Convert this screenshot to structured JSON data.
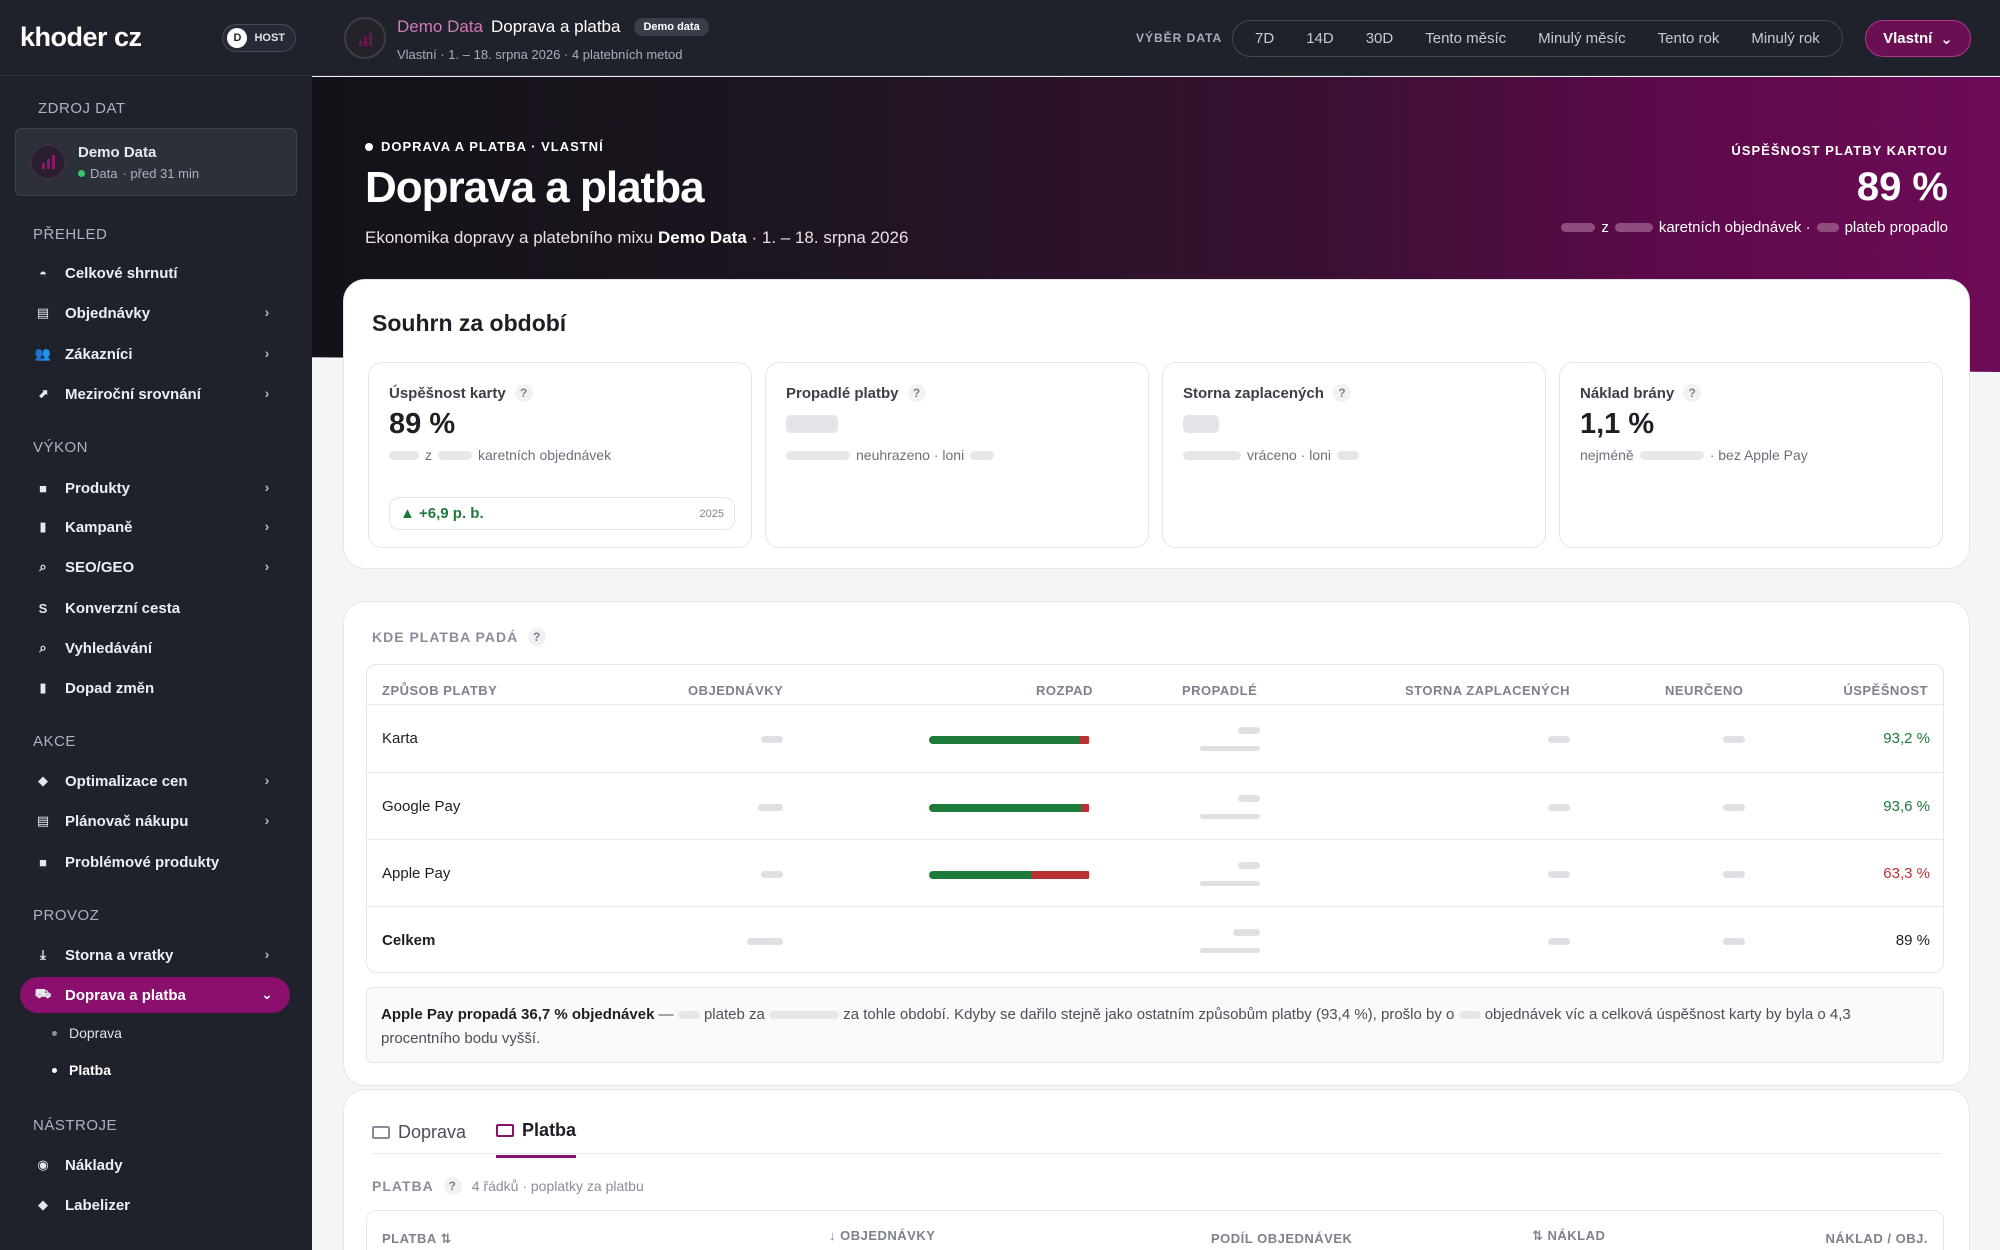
{
  "sidebar": {
    "brand": "khoder cz",
    "host": {
      "initial": "D",
      "label": "HOST"
    },
    "source": {
      "section": "ZDROJ DAT",
      "name": "Demo Data",
      "status": "Data",
      "time": "· před 31 min"
    },
    "sections": {
      "overview": "PŘEHLED",
      "performance": "VÝKON",
      "actions": "AKCE",
      "operations": "PROVOZ",
      "tools": "NÁSTROJE"
    },
    "items": [
      {
        "label": "Celkové shrnutí"
      },
      {
        "label": "Objednávky"
      },
      {
        "label": "Zákazníci"
      },
      {
        "label": "Meziroční srovnání"
      },
      {
        "label": "Produkty"
      },
      {
        "label": "Kampaně"
      },
      {
        "label": "SEO/GEO"
      },
      {
        "label": "Konverzní cesta"
      },
      {
        "label": "Vyhledávání"
      },
      {
        "label": "Dopad změn"
      },
      {
        "label": "Optimalizace cen"
      },
      {
        "label": "Plánovač nákupu"
      },
      {
        "label": "Problémové produkty"
      },
      {
        "label": "Storna a vratky"
      },
      {
        "label": "Doprava a platba"
      },
      {
        "label": "Náklady"
      },
      {
        "label": "Labelizer"
      }
    ],
    "subitems": [
      {
        "label": "Doprava"
      },
      {
        "label": "Platba"
      }
    ]
  },
  "topbar": {
    "crumb_source": "Demo Data",
    "crumb_page": "Doprava a platba",
    "badge": "Demo data",
    "subtitle": "Vlastní · 1. – 18. srpna 2026 · 4 platebních metod",
    "range_label": "VÝBĚR DATA",
    "ranges": [
      "7D",
      "14D",
      "30D",
      "Tento měsíc",
      "Minulý měsíc",
      "Tento rok",
      "Minulý rok"
    ],
    "custom": "Vlastní"
  },
  "hero": {
    "tag": "DOPRAVA A PLATBA · VLASTNÍ",
    "title": "Doprava a platba",
    "subtitle_pre": "Ekonomika dopravy a platebního mixu",
    "subtitle_bold": "Demo Data",
    "subtitle_post": "· 1. – 18. srpna 2026",
    "kpi_label": "ÚSPĚŠNOST PLATBY KARTOU",
    "kpi_value": "89 %",
    "kpi_z": "z",
    "kpi_mid": "karetních objednávek ·",
    "kpi_end": "plateb propadlo"
  },
  "summary": {
    "title": "Souhrn za období",
    "cards": [
      {
        "label": "Úspěšnost karty",
        "value": "89 %",
        "sub_z": "z",
        "sub": "karetních objednávek",
        "trend": "▲ +6,9 p. b.",
        "trend_year": "2025"
      },
      {
        "label": "Propadlé platby",
        "sub": "neuhrazeno · loni"
      },
      {
        "label": "Storna zaplacených",
        "sub": "vráceno · loni"
      },
      {
        "label": "Náklad brány",
        "value": "1,1 %",
        "sub_pre": "nejméně",
        "sub": "· bez Apple Pay"
      }
    ]
  },
  "failures": {
    "title": "KDE PLATBA PADÁ",
    "columns": [
      "ZPŮSOB PLATBY",
      "OBJEDNÁVKY",
      "ROZPAD",
      "PROPADLÉ",
      "STORNA ZAPLACENÝCH",
      "NEURČENO",
      "ÚSPĚŠNOST"
    ],
    "rows": [
      {
        "name": "Karta",
        "success": "93,2 %",
        "success_pct": 0.932,
        "color": "#1e7a3a"
      },
      {
        "name": "Google Pay",
        "success": "93,6 %",
        "success_pct": 0.936,
        "color": "#1e7a3a"
      },
      {
        "name": "Apple Pay",
        "success": "63,3 %",
        "success_pct": 0.633,
        "color": "#b83232"
      },
      {
        "name": "Celkem",
        "success": "89 %",
        "color": "#1d1f24"
      }
    ],
    "note_bold": "Apple Pay propadá 36,7 % objednávek",
    "note_1": "—",
    "note_2": "plateb za",
    "note_3": "za tohle období. Kdyby se dařilo stejně jako ostatním způsobům platby (93,4 %), prošlo by o",
    "note_4": "objednávek víc a celková úspěšnost karty by byla o 4,3 procentního bodu vyšší."
  },
  "detail": {
    "tabs": [
      {
        "label": "Doprava",
        "icon": "truck-icon"
      },
      {
        "label": "Platba",
        "icon": "card-icon"
      }
    ],
    "section": "PLATBA",
    "section_meta": "4 řádků · poplatky za platbu",
    "columns": [
      "PLATBA ⇅",
      "↓ OBJEDNÁVKY",
      "PODÍL OBJEDNÁVEK",
      "⇅ NÁKLAD",
      "NÁKLAD / OBJ."
    ]
  }
}
